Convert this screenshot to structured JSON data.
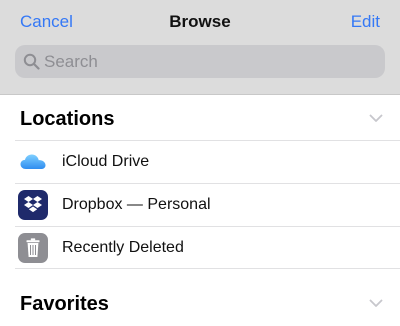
{
  "nav": {
    "cancel": "Cancel",
    "title": "Browse",
    "edit": "Edit"
  },
  "search": {
    "placeholder": "Search"
  },
  "sections": {
    "locations": {
      "title": "Locations",
      "items": [
        {
          "label": "iCloud Drive",
          "icon": "icloud-icon"
        },
        {
          "label": "Dropbox — Personal",
          "icon": "dropbox-icon"
        },
        {
          "label": "Recently Deleted",
          "icon": "trash-icon"
        }
      ]
    },
    "favorites": {
      "title": "Favorites"
    }
  },
  "colors": {
    "accent": "#3478f6",
    "header_bg": "#dcdcdc",
    "search_bg": "#c9c9cc",
    "dropbox_bg": "#1f2a6b",
    "trash_bg": "#8e8e93"
  }
}
